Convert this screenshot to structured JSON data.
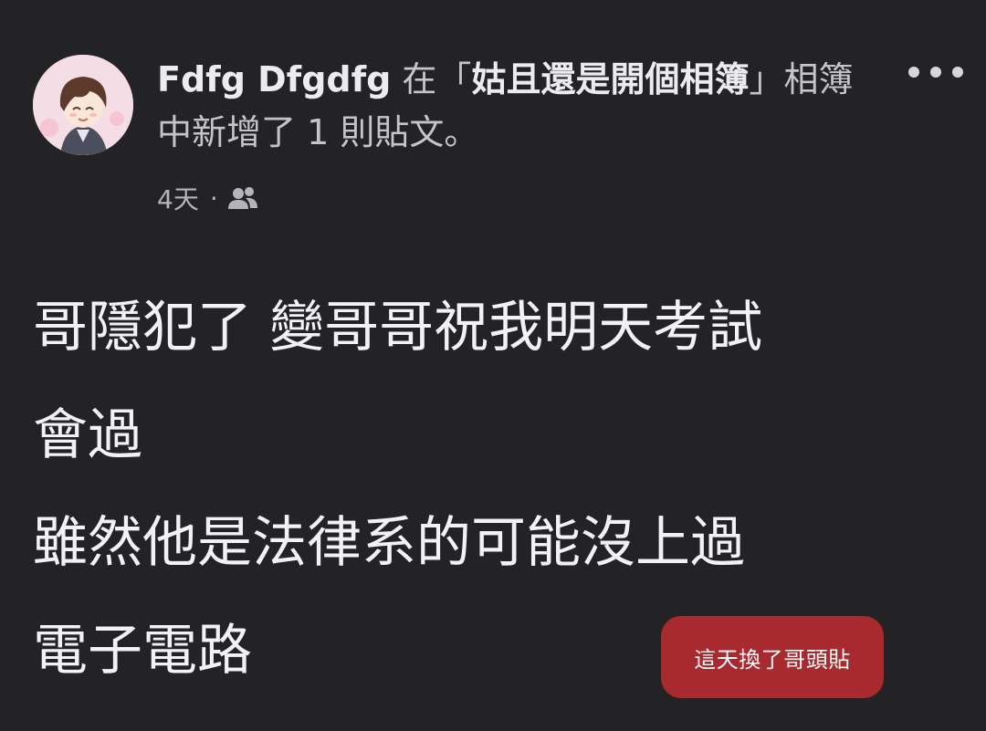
{
  "header": {
    "author_name": "Fdfg Dfgdfg",
    "in_word": " 在「",
    "album_name": "姑且還是開個相簿",
    "close_bracket": "」相簿中新增了 1 則貼文。"
  },
  "meta": {
    "time": "4天",
    "separator": "·",
    "audience_icon": "friends-icon"
  },
  "post": {
    "lines": [
      "哥隱犯了 變哥哥祝我明天考試",
      "會過",
      "雖然他是法律系的可能沒上過",
      "電子電路"
    ]
  },
  "sticker": {
    "text": "這天換了哥頭貼"
  },
  "colors": {
    "background": "#232325",
    "sticker": "#a82a2e"
  }
}
